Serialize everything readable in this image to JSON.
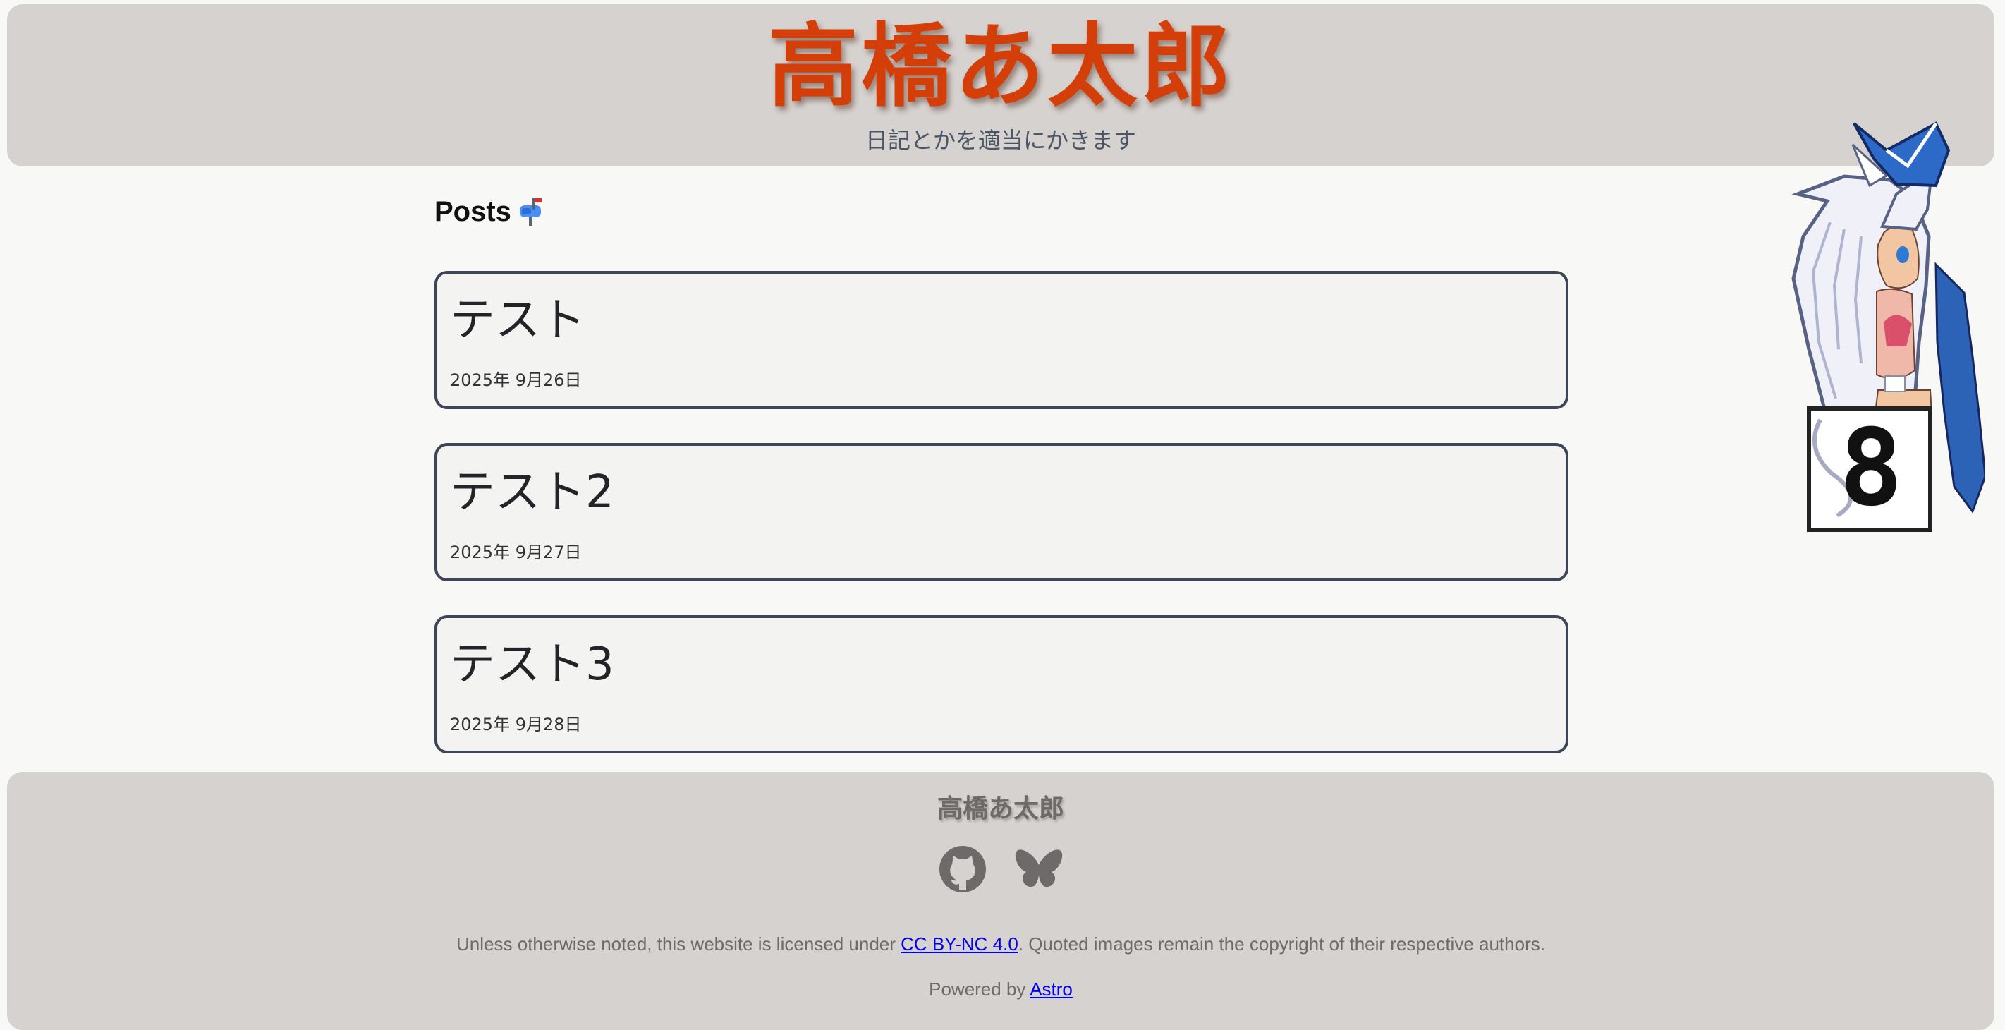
{
  "header": {
    "title": "高橋あ太郎",
    "subtitle": "日記とかを適当にかきます"
  },
  "main": {
    "heading": "Posts",
    "heading_icon": "mailbox-icon",
    "posts": [
      {
        "title": "テスト",
        "date": "2025年 9月26日"
      },
      {
        "title": "テスト2",
        "date": "2025年 9月27日"
      },
      {
        "title": "テスト3",
        "date": "2025年 9月28日"
      }
    ]
  },
  "mascot": {
    "sign_text": "8"
  },
  "footer": {
    "title": "高橋あ太郎",
    "social": [
      {
        "name": "GitHub",
        "icon": "github-icon"
      },
      {
        "name": "Bluesky",
        "icon": "bluesky-icon"
      }
    ],
    "license_prefix": "Unless otherwise noted, this website is licensed under ",
    "license_link": "CC BY-NC 4.0",
    "license_suffix": ". Quoted images remain the copyright of their respective authors.",
    "powered_prefix": "Powered by ",
    "powered_link": "Astro"
  },
  "colors": {
    "accent": "#d43e09",
    "panel": "#d6d2cf",
    "page_background": "#f8f8f6",
    "card_border": "#3e4656",
    "link": "#0000ee"
  }
}
